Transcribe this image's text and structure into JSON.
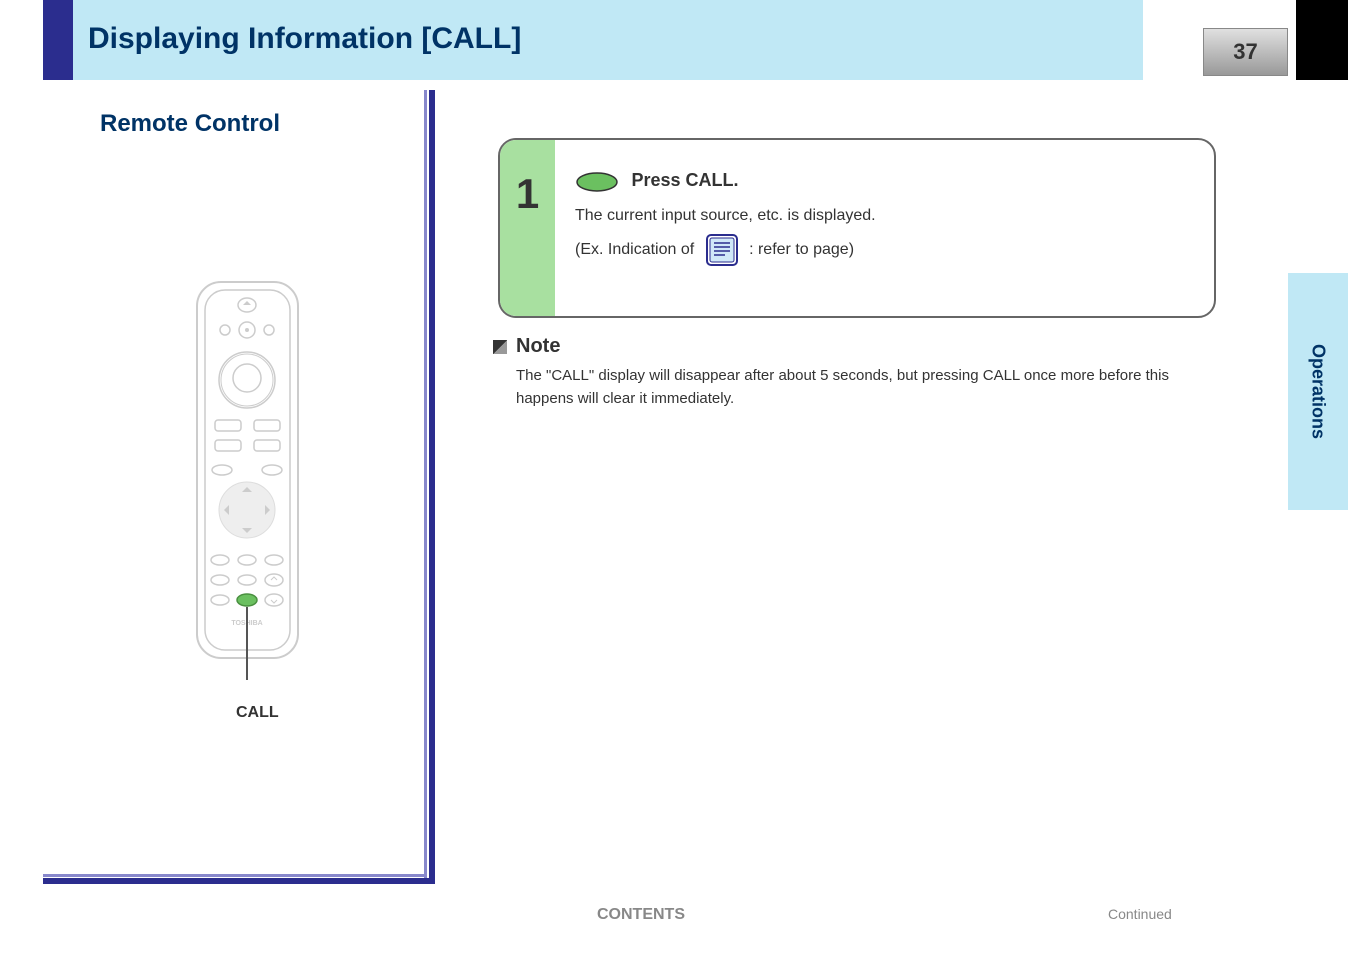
{
  "header": {
    "title": "Displaying Information [CALL]",
    "page_number": "37"
  },
  "side_tab": "Operations",
  "left_panel": {
    "title": "Remote Control",
    "call_label": "CALL",
    "brand": "TOSHIBA"
  },
  "instruction": {
    "number": "1",
    "button_label": "CALL",
    "main_text": "Press CALL.",
    "sub_line1": "The current input source, etc. is displayed.",
    "ex_prefix": "(Ex. Indication of",
    "ex_suffix": ": refer to page)"
  },
  "note": {
    "title": "Note",
    "text": "The \"CALL\" display will disappear after about 5 seconds, but pressing CALL once more before this happens will clear it immediately."
  },
  "footer": {
    "contents": "CONTENTS",
    "continued": "Continued"
  }
}
